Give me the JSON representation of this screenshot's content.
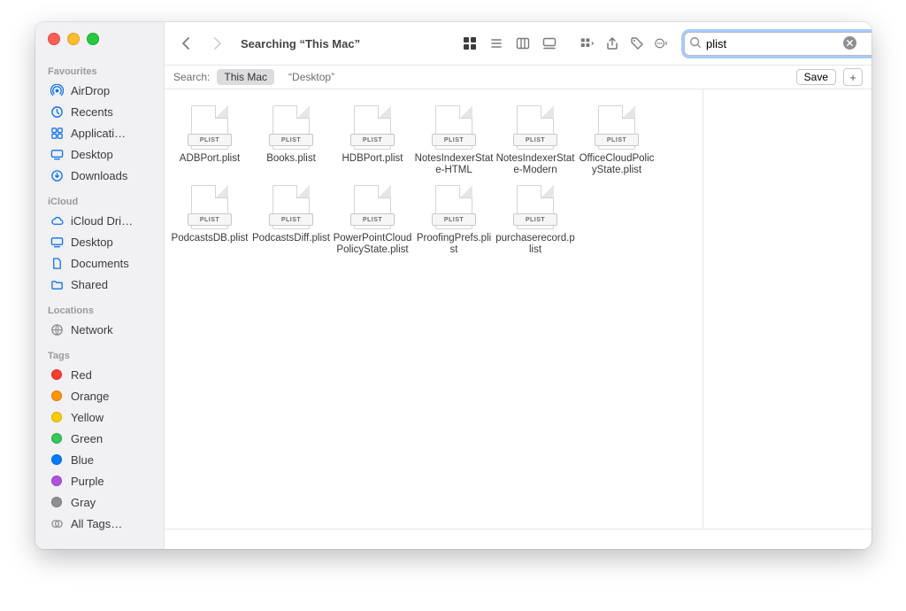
{
  "header": {
    "title": "Searching “This Mac”",
    "search_value": "plist"
  },
  "scope": {
    "label": "Search:",
    "options": [
      "This Mac",
      "“Desktop”"
    ],
    "save_label": "Save"
  },
  "sidebar": {
    "sections": [
      {
        "title": "Favourites",
        "items": [
          {
            "icon": "airdrop",
            "label": "AirDrop"
          },
          {
            "icon": "clock",
            "label": "Recents"
          },
          {
            "icon": "apps",
            "label": "Applicati…"
          },
          {
            "icon": "desktop",
            "label": "Desktop"
          },
          {
            "icon": "download",
            "label": "Downloads"
          }
        ]
      },
      {
        "title": "iCloud",
        "items": [
          {
            "icon": "cloud",
            "label": "iCloud Dri…"
          },
          {
            "icon": "desktop",
            "label": "Desktop"
          },
          {
            "icon": "document",
            "label": "Documents"
          },
          {
            "icon": "folder",
            "label": "Shared"
          }
        ]
      },
      {
        "title": "Locations",
        "items": [
          {
            "icon": "network",
            "label": "Network",
            "gray": true
          }
        ]
      },
      {
        "title": "Tags",
        "items": [
          {
            "tag": "red",
            "label": "Red"
          },
          {
            "tag": "orange",
            "label": "Orange"
          },
          {
            "tag": "yellow",
            "label": "Yellow"
          },
          {
            "tag": "green",
            "label": "Green"
          },
          {
            "tag": "blue",
            "label": "Blue"
          },
          {
            "tag": "purple",
            "label": "Purple"
          },
          {
            "tag": "gray",
            "label": "Gray"
          },
          {
            "icon": "alltags",
            "label": "All Tags…",
            "gray": true
          }
        ]
      }
    ]
  },
  "file_badge": "PLIST",
  "files": [
    "ADBPort.plist",
    "Books.plist",
    "HDBPort.plist",
    "NotesIndexerState-HTML",
    "NotesIndexerState-Modern",
    "OfficeCloudPolicyState.plist",
    "PodcastsDB.plist",
    "PodcastsDiff.plist",
    "PowerPointCloudPolicyState.plist",
    "ProofingPrefs.plist",
    "purchaserecord.plist"
  ]
}
